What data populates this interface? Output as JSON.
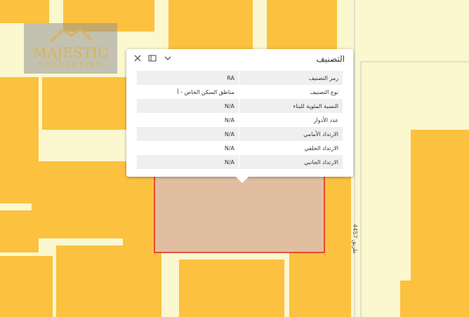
{
  "popup": {
    "title": "التصنيف",
    "rows": [
      {
        "label": "رمز التصنيف",
        "value": "RA"
      },
      {
        "label": "نوع التصنيف",
        "value": "مناطق السكن الخاص - أ"
      },
      {
        "label": "النسبة المئوية للبناء",
        "value": "N/A"
      },
      {
        "label": "عدد الأدوار",
        "value": "N/A"
      },
      {
        "label": "الارتداد الأمامي",
        "value": "N/A"
      },
      {
        "label": "الارتداد الخلفي",
        "value": "N/A"
      },
      {
        "label": "الارتداد الجانبي",
        "value": "N/A"
      }
    ],
    "icons": [
      "close-icon",
      "dock-icon",
      "chevron-down-icon"
    ]
  },
  "logo": {
    "name": "MAJESTIC",
    "tagline": "PROPERTIES"
  },
  "road": {
    "label": "طريق 4457"
  },
  "colors": {
    "background": "#fbf7cf",
    "parcel": "#fcc13f",
    "selection_fill": "#e2bea0",
    "selection_border": "#e0261d",
    "road_line": "#c9c9c9"
  }
}
